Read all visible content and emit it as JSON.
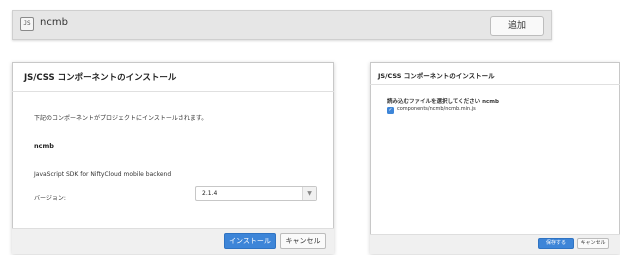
{
  "topbar": {
    "icon": "js-package-icon",
    "icon_text": "JS",
    "package_name": "ncmb",
    "add_label": "追加"
  },
  "install_dialog": {
    "title": "JS/CSS コンポーネントのインストール",
    "description": "下記のコンポーネントがプロジェクトにインストールされます。",
    "component_name": "ncmb",
    "component_description": "JavaScript SDK for NiftyCloud mobile backend",
    "version_label": "バージョン:",
    "version_value": "2.1.4",
    "install_label": "インストール",
    "cancel_label": "キャンセル"
  },
  "file_dialog": {
    "title": "JS/CSS コンポーネントのインストール",
    "select_title": "読み込むファイルを選択してください ncmb",
    "files": [
      {
        "path": "components/ncmb/ncmb.min.js",
        "checked": true
      }
    ],
    "save_label": "保存する",
    "cancel_label": "キャンセル"
  },
  "colors": {
    "primary": "#3d85d8",
    "topbar_bg": "#e6e6e6"
  }
}
